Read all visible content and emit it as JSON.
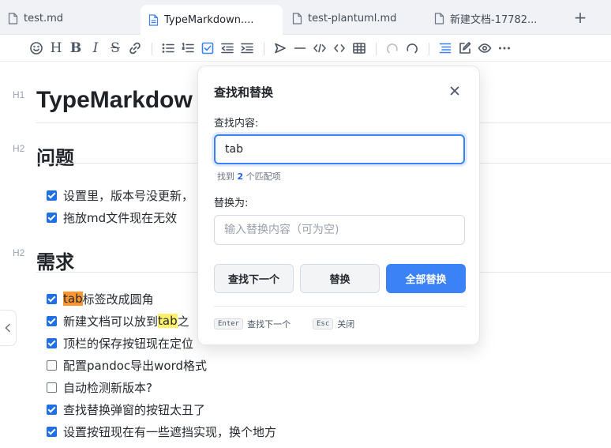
{
  "tabs": [
    {
      "label": "test.md",
      "active": false
    },
    {
      "label": "TypeMarkdown....",
      "active": true
    },
    {
      "label": "test-plantuml.md",
      "active": false
    },
    {
      "label": "新建文档-17782...",
      "active": false
    }
  ],
  "add_tab_label": "+",
  "toolbar": {
    "heading_label": "H",
    "bold_label": "B",
    "italic_label": "I",
    "strike_label": "S",
    "icons": [
      "emoji-icon",
      "heading-icon",
      "bold-icon",
      "italic-icon",
      "strikethrough-icon",
      "link-icon",
      "bullet-list-icon",
      "ordered-list-icon",
      "task-list-icon",
      "outdent-icon",
      "indent-icon",
      "quote-icon",
      "horizontal-rule-icon",
      "code-block-icon",
      "inline-code-icon",
      "table-icon",
      "undo-icon",
      "redo-icon",
      "toc-icon",
      "edit-mode-icon",
      "preview-icon",
      "more-icon"
    ]
  },
  "document": {
    "h1_marker": "H1",
    "h1": "TypeMarkdow",
    "sections": [
      {
        "marker": "H2",
        "title": "问题",
        "tasks": [
          {
            "checked": true,
            "text": "设置里，版本号没更新，"
          },
          {
            "checked": true,
            "text": "拖放md文件现在无效"
          }
        ]
      },
      {
        "marker": "H2",
        "title": "需求",
        "tasks": [
          {
            "checked": true,
            "prefix": "",
            "match": "tab",
            "suffix": "标签改成圆角"
          },
          {
            "checked": true,
            "prefix": "新建文档可以放到",
            "match": "tab",
            "suffix": "之"
          },
          {
            "checked": true,
            "text": "顶栏的保存按钮现在定位"
          },
          {
            "checked": false,
            "text": "配置pandoc导出word格式"
          },
          {
            "checked": false,
            "text": "自动检测新版本?"
          },
          {
            "checked": true,
            "text": "查找替换弹窗的按钮太丑了"
          },
          {
            "checked": true,
            "text": "设置按钮现在有一些遮挡实现，换个地方"
          }
        ]
      }
    ]
  },
  "find_replace": {
    "title": "查找和替换",
    "find_label": "查找内容:",
    "find_value": "tab",
    "match_prefix": "找到",
    "match_count": "2",
    "match_suffix": "个匹配项",
    "replace_label": "替换为:",
    "replace_placeholder": "输入替换内容（可为空)",
    "find_next_label": "查找下一个",
    "replace_label_btn": "替换",
    "replace_all_label": "全部替换",
    "hint_enter_key": "Enter",
    "hint_enter_text": "查找下一个",
    "hint_esc_key": "Esc",
    "hint_esc_text": "关闭"
  },
  "colors": {
    "accent": "#3b82f6",
    "current_match": "#ff9632",
    "match": "#fff06b",
    "checkbox": "#1f6fe5"
  }
}
